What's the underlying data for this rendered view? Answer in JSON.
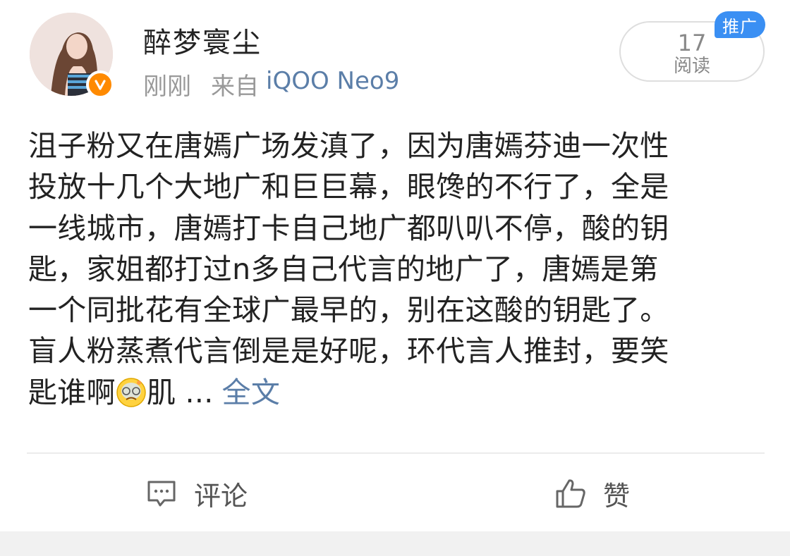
{
  "post": {
    "author": "醉梦寰尘",
    "time": "刚刚",
    "from_label": "来自",
    "device": "iQOO Neo9",
    "read_count": "17",
    "read_label": "阅读",
    "promo_badge": "推广",
    "lines": [
      "沮子粉又在唐嫣广场发滇了，因为唐嫣芬迪一次性",
      "投放十几个大地广和巨巨幕，眼馋的不行了，全是",
      "一线城市，唐嫣打卡自己地广都叭叭不停，酸的钥",
      "匙，家姐都打过n多自己代言的地广了，唐嫣是第",
      "一个同批花有全球广最早的，别在这酸的钥匙了。",
      "盲人粉蒸煮代言倒是是好呢，环代言人推封，要笑"
    ],
    "last_line_before_emoji": "匙谁啊",
    "last_line_after_emoji": "肌 ...",
    "fulltext_link": "全文",
    "emoji_name": "dizzy-face-emoji"
  },
  "actions": {
    "comment_label": "评论",
    "like_label": "赞"
  },
  "colors": {
    "link": "#5b7ea8",
    "badge": "#3a8ff3",
    "verified": "#ff8a00"
  }
}
